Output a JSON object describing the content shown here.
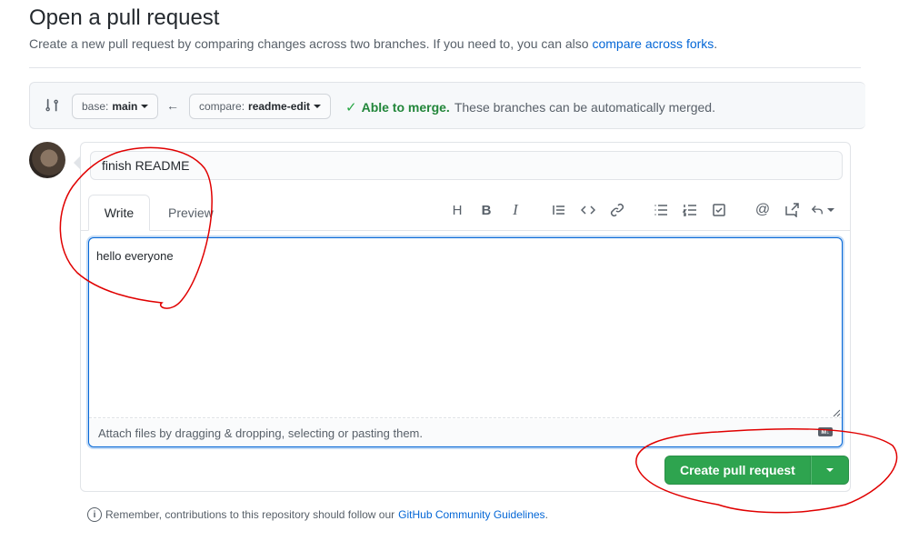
{
  "page": {
    "title": "Open a pull request",
    "subtitle_text": "Create a new pull request by comparing changes across two branches. If you need to, you can also",
    "subtitle_link": "compare across forks",
    "subtitle_end": "."
  },
  "compare": {
    "base_prefix": "base:",
    "base_branch": "main",
    "compare_prefix": "compare:",
    "compare_branch": "readme-edit",
    "merge_status": "Able to merge.",
    "merge_detail": "These branches can be automatically merged."
  },
  "form": {
    "title_value": "finish README",
    "tabs": [
      "Write",
      "Preview"
    ],
    "body_value": "hello everyone",
    "attach_text": "Attach files by dragging & dropping, selecting or pasting them.",
    "toolbar_icons": [
      "heading-icon",
      "bold-icon",
      "italic-icon",
      "quote-icon",
      "code-icon",
      "link-icon",
      "unordered-list-icon",
      "ordered-list-icon",
      "task-list-icon",
      "mention-icon",
      "cross-reference-icon",
      "saved-reply-icon"
    ],
    "markdown_badge": "M↓"
  },
  "actions": {
    "create_label": "Create pull request"
  },
  "footer": {
    "text": "Remember, contributions to this repository should follow our",
    "link": "GitHub Community Guidelines",
    "end": "."
  },
  "colors": {
    "primary_button": "#2ea44f",
    "link": "#0366d6",
    "success": "#22863a",
    "annotation": "#e00000"
  }
}
